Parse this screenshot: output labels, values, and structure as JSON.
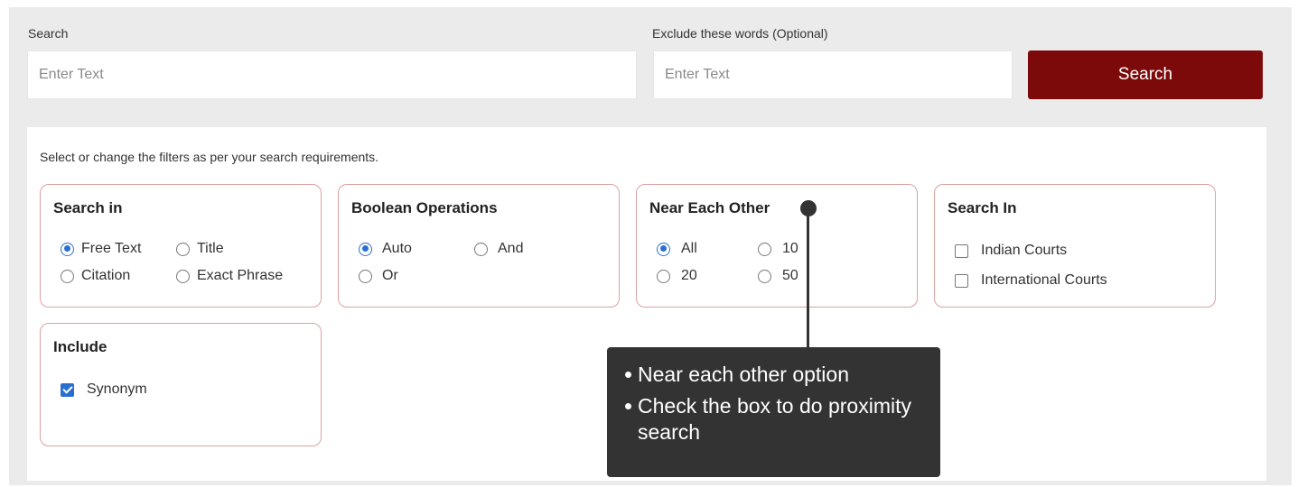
{
  "search": {
    "label": "Search",
    "placeholder": "Enter Text",
    "value": "",
    "exclude_label": "Exclude these words (Optional)",
    "exclude_placeholder": "Enter Text",
    "exclude_value": "",
    "button_label": "Search"
  },
  "filters": {
    "hint": "Select or change the filters as per your search requirements.",
    "search_in": {
      "title": "Search in",
      "options": [
        "Free Text",
        "Title",
        "Citation",
        "Exact Phrase"
      ],
      "selected": "Free Text"
    },
    "boolean": {
      "title": "Boolean Operations",
      "options": [
        "Auto",
        "And",
        "Or"
      ],
      "selected": "Auto"
    },
    "near": {
      "title": "Near Each Other",
      "options": [
        "All",
        "10",
        "20",
        "50"
      ],
      "selected": "All"
    },
    "courts": {
      "title": "Search In",
      "options": [
        "Indian Courts",
        "International Courts"
      ],
      "checked": []
    },
    "include": {
      "title": "Include",
      "options": [
        "Synonym"
      ],
      "checked": [
        "Synonym"
      ]
    }
  },
  "tooltip": {
    "items": [
      "Near each other option",
      "Check the box to do proximity search"
    ]
  },
  "colors": {
    "accent": "#7d0a0a",
    "card_border": "#dca1a1",
    "control": "#2a6fd0",
    "tooltip_bg": "#333333",
    "panel_bg": "#ebebeb"
  }
}
